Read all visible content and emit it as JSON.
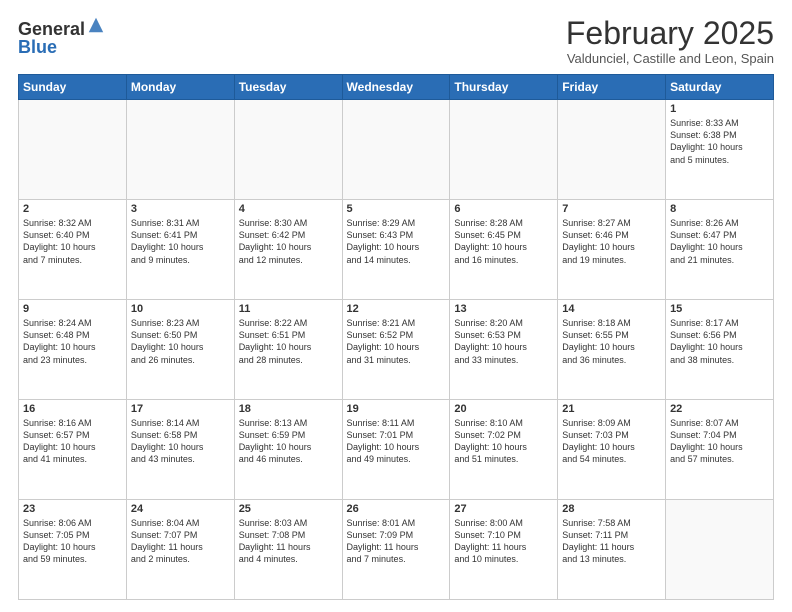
{
  "logo": {
    "general": "General",
    "blue": "Blue"
  },
  "header": {
    "month": "February 2025",
    "location": "Valdunciel, Castille and Leon, Spain"
  },
  "weekdays": [
    "Sunday",
    "Monday",
    "Tuesday",
    "Wednesday",
    "Thursday",
    "Friday",
    "Saturday"
  ],
  "weeks": [
    [
      {
        "day": "",
        "info": ""
      },
      {
        "day": "",
        "info": ""
      },
      {
        "day": "",
        "info": ""
      },
      {
        "day": "",
        "info": ""
      },
      {
        "day": "",
        "info": ""
      },
      {
        "day": "",
        "info": ""
      },
      {
        "day": "1",
        "info": "Sunrise: 8:33 AM\nSunset: 6:38 PM\nDaylight: 10 hours\nand 5 minutes."
      }
    ],
    [
      {
        "day": "2",
        "info": "Sunrise: 8:32 AM\nSunset: 6:40 PM\nDaylight: 10 hours\nand 7 minutes."
      },
      {
        "day": "3",
        "info": "Sunrise: 8:31 AM\nSunset: 6:41 PM\nDaylight: 10 hours\nand 9 minutes."
      },
      {
        "day": "4",
        "info": "Sunrise: 8:30 AM\nSunset: 6:42 PM\nDaylight: 10 hours\nand 12 minutes."
      },
      {
        "day": "5",
        "info": "Sunrise: 8:29 AM\nSunset: 6:43 PM\nDaylight: 10 hours\nand 14 minutes."
      },
      {
        "day": "6",
        "info": "Sunrise: 8:28 AM\nSunset: 6:45 PM\nDaylight: 10 hours\nand 16 minutes."
      },
      {
        "day": "7",
        "info": "Sunrise: 8:27 AM\nSunset: 6:46 PM\nDaylight: 10 hours\nand 19 minutes."
      },
      {
        "day": "8",
        "info": "Sunrise: 8:26 AM\nSunset: 6:47 PM\nDaylight: 10 hours\nand 21 minutes."
      }
    ],
    [
      {
        "day": "9",
        "info": "Sunrise: 8:24 AM\nSunset: 6:48 PM\nDaylight: 10 hours\nand 23 minutes."
      },
      {
        "day": "10",
        "info": "Sunrise: 8:23 AM\nSunset: 6:50 PM\nDaylight: 10 hours\nand 26 minutes."
      },
      {
        "day": "11",
        "info": "Sunrise: 8:22 AM\nSunset: 6:51 PM\nDaylight: 10 hours\nand 28 minutes."
      },
      {
        "day": "12",
        "info": "Sunrise: 8:21 AM\nSunset: 6:52 PM\nDaylight: 10 hours\nand 31 minutes."
      },
      {
        "day": "13",
        "info": "Sunrise: 8:20 AM\nSunset: 6:53 PM\nDaylight: 10 hours\nand 33 minutes."
      },
      {
        "day": "14",
        "info": "Sunrise: 8:18 AM\nSunset: 6:55 PM\nDaylight: 10 hours\nand 36 minutes."
      },
      {
        "day": "15",
        "info": "Sunrise: 8:17 AM\nSunset: 6:56 PM\nDaylight: 10 hours\nand 38 minutes."
      }
    ],
    [
      {
        "day": "16",
        "info": "Sunrise: 8:16 AM\nSunset: 6:57 PM\nDaylight: 10 hours\nand 41 minutes."
      },
      {
        "day": "17",
        "info": "Sunrise: 8:14 AM\nSunset: 6:58 PM\nDaylight: 10 hours\nand 43 minutes."
      },
      {
        "day": "18",
        "info": "Sunrise: 8:13 AM\nSunset: 6:59 PM\nDaylight: 10 hours\nand 46 minutes."
      },
      {
        "day": "19",
        "info": "Sunrise: 8:11 AM\nSunset: 7:01 PM\nDaylight: 10 hours\nand 49 minutes."
      },
      {
        "day": "20",
        "info": "Sunrise: 8:10 AM\nSunset: 7:02 PM\nDaylight: 10 hours\nand 51 minutes."
      },
      {
        "day": "21",
        "info": "Sunrise: 8:09 AM\nSunset: 7:03 PM\nDaylight: 10 hours\nand 54 minutes."
      },
      {
        "day": "22",
        "info": "Sunrise: 8:07 AM\nSunset: 7:04 PM\nDaylight: 10 hours\nand 57 minutes."
      }
    ],
    [
      {
        "day": "23",
        "info": "Sunrise: 8:06 AM\nSunset: 7:05 PM\nDaylight: 10 hours\nand 59 minutes."
      },
      {
        "day": "24",
        "info": "Sunrise: 8:04 AM\nSunset: 7:07 PM\nDaylight: 11 hours\nand 2 minutes."
      },
      {
        "day": "25",
        "info": "Sunrise: 8:03 AM\nSunset: 7:08 PM\nDaylight: 11 hours\nand 4 minutes."
      },
      {
        "day": "26",
        "info": "Sunrise: 8:01 AM\nSunset: 7:09 PM\nDaylight: 11 hours\nand 7 minutes."
      },
      {
        "day": "27",
        "info": "Sunrise: 8:00 AM\nSunset: 7:10 PM\nDaylight: 11 hours\nand 10 minutes."
      },
      {
        "day": "28",
        "info": "Sunrise: 7:58 AM\nSunset: 7:11 PM\nDaylight: 11 hours\nand 13 minutes."
      },
      {
        "day": "",
        "info": ""
      }
    ]
  ]
}
